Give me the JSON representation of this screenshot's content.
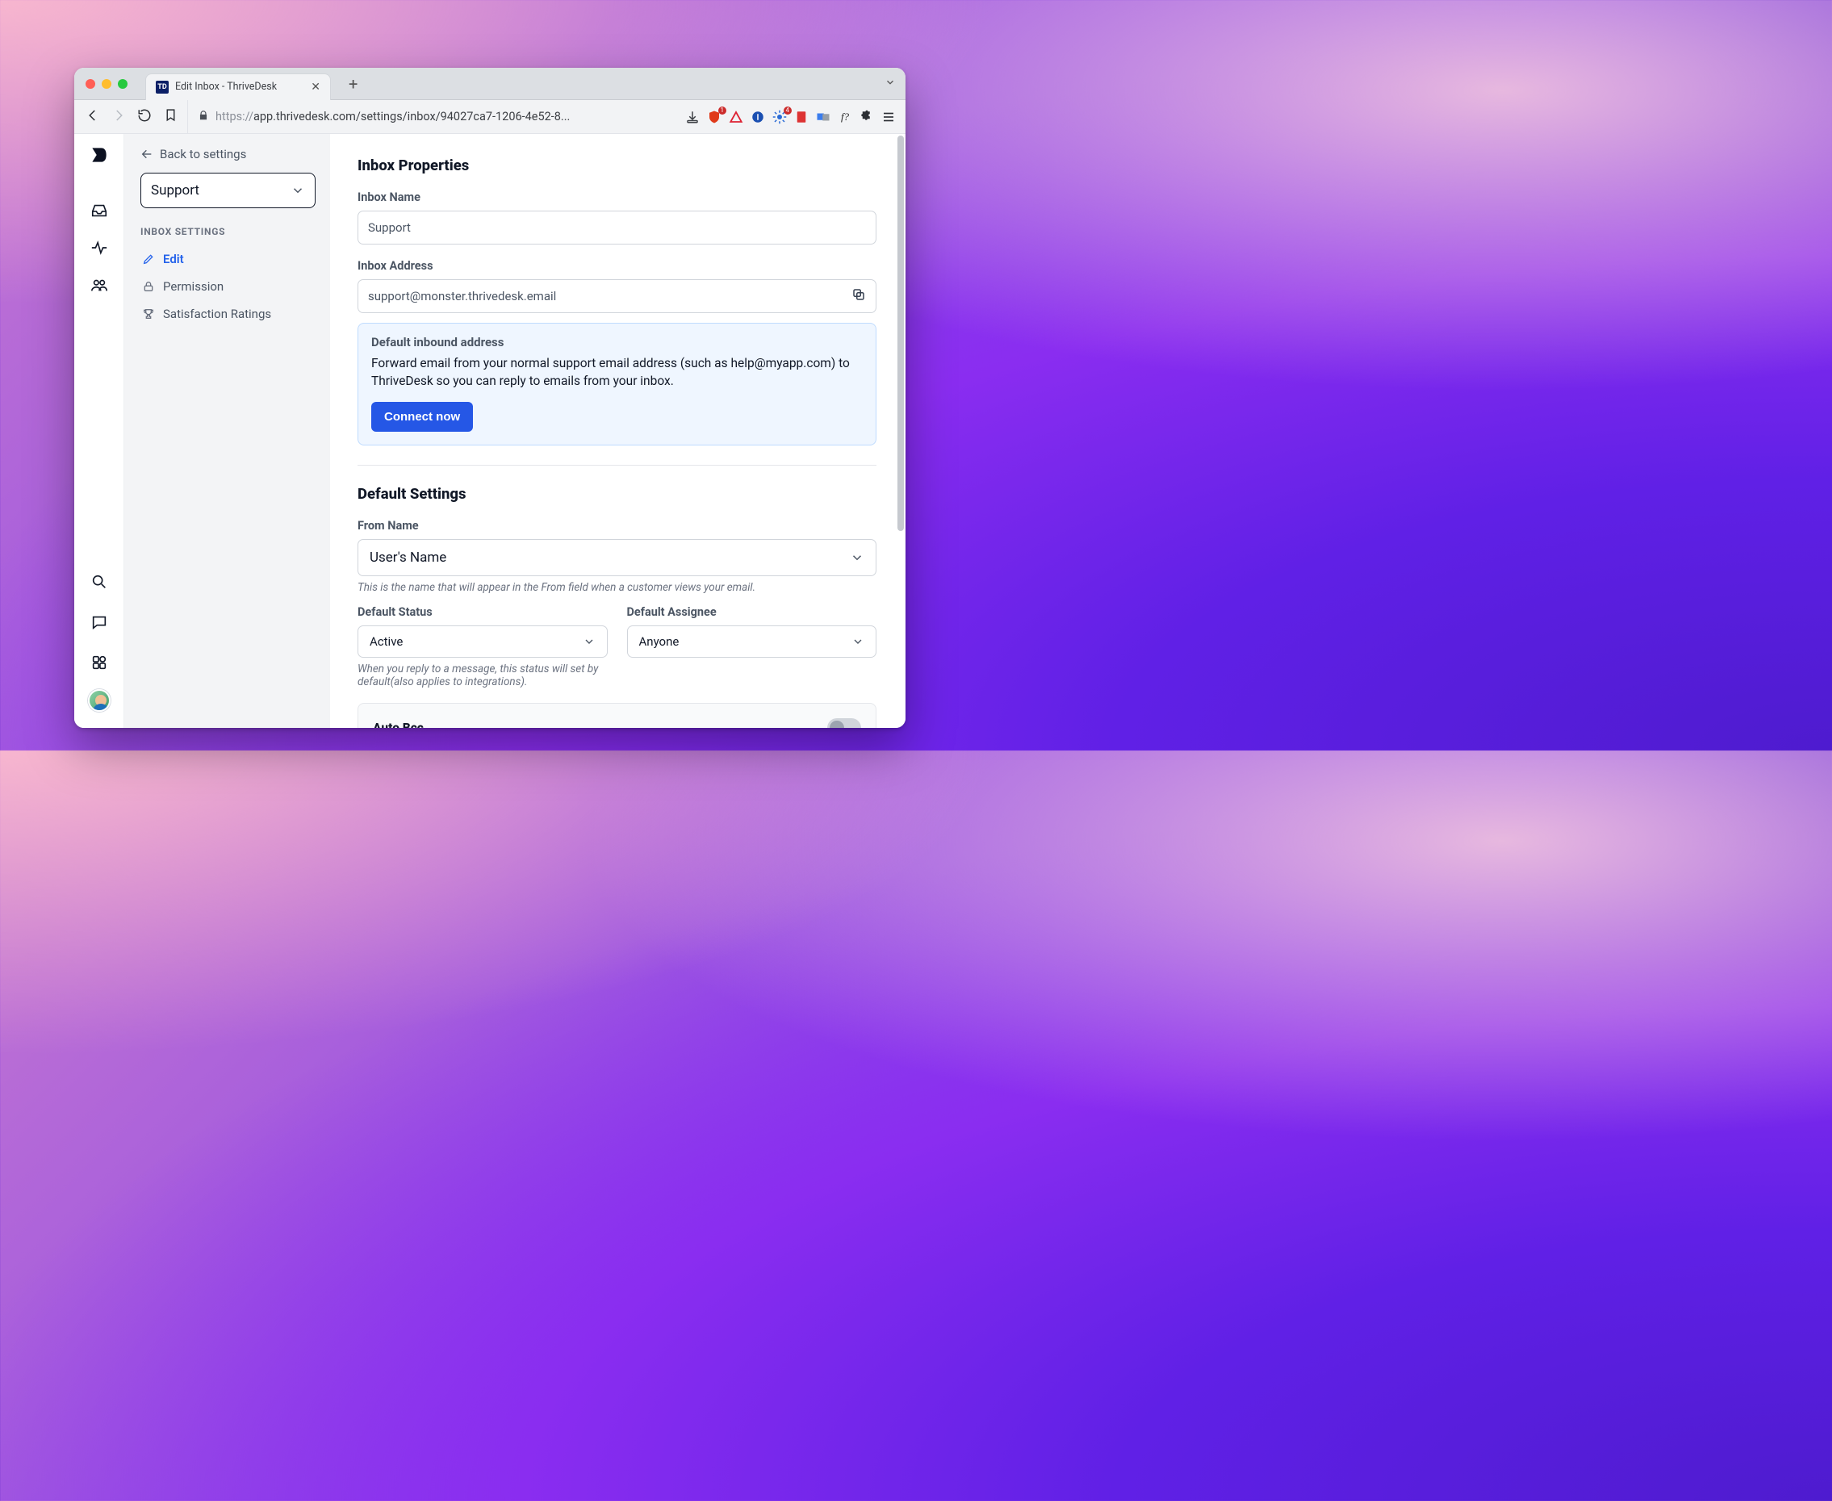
{
  "tab": {
    "title": "Edit Inbox - ThriveDesk",
    "favicon_letters": "TD"
  },
  "url": {
    "prefix": "https://",
    "host": "app.thrivedesk.com",
    "path": "/settings/inbox/94027ca7-1206-4e52-8...",
    "full_display_prefix": "https://",
    "full_display_rest": "app.thrivedesk.com/settings/inbox/94027ca7-1206-4e52-8..."
  },
  "ext": {
    "brave_badge": "1",
    "gear_badge": "4"
  },
  "side": {
    "back_label": "Back to settings",
    "selector_value": "Support",
    "heading": "INBOX SETTINGS",
    "items": [
      {
        "label": "Edit"
      },
      {
        "label": "Permission"
      },
      {
        "label": "Satisfaction Ratings"
      }
    ]
  },
  "sections": {
    "inbox_properties": {
      "title": "Inbox Properties",
      "inbox_name_label": "Inbox Name",
      "inbox_name_value": "Support",
      "inbox_address_label": "Inbox Address",
      "inbox_address_value": "support@monster.thrivedesk.email",
      "callout": {
        "title": "Default inbound address",
        "text": "Forward email from your normal support email address (such as help@myapp.com) to ThriveDesk so you can reply to emails from your inbox.",
        "button": "Connect now"
      }
    },
    "default_settings": {
      "title": "Default Settings",
      "from_name_label": "From Name",
      "from_name_value": "User's Name",
      "from_name_hint": "This is the name that will appear in the From field when a customer views your email.",
      "default_status_label": "Default Status",
      "default_status_value": "Active",
      "default_status_hint": "When you reply to a message, this status will set by default(also applies to integrations).",
      "default_assignee_label": "Default Assignee",
      "default_assignee_value": "Anyone",
      "auto_bcc_label": "Auto Bcc"
    }
  }
}
